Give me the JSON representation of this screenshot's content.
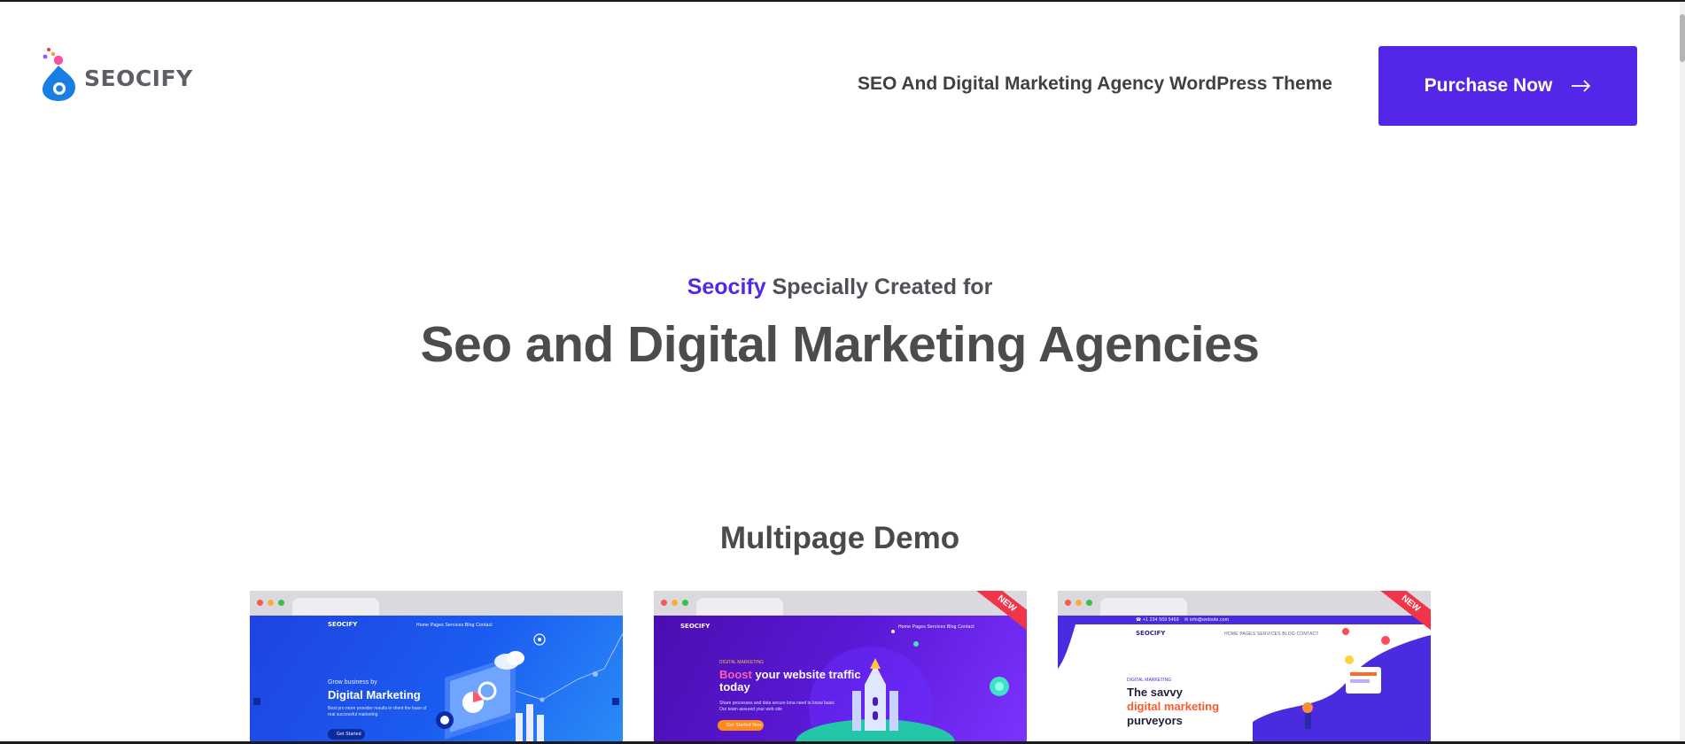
{
  "header": {
    "logo_text": "SEOCIFY",
    "tagline": "SEO And Digital Marketing Agency WordPress Theme",
    "purchase_label": "Purchase Now"
  },
  "hero": {
    "kicker_brand": "Seocify",
    "kicker_rest": " Specially Created for",
    "title": "Seo and Digital Marketing Agencies"
  },
  "section": {
    "title": "Multipage Demo"
  },
  "demos": [
    {
      "logo": "SEOCIFY",
      "nav": "Home     Pages     Services     Blog     Contact",
      "kicker": "Grow business by",
      "headline": "Digital Marketing",
      "paragraph": "Best pro more provider results in client the base of real successful marketing",
      "button": "Get Started"
    },
    {
      "logo": "SEOCIFY",
      "nav": "Home     Pages     Services     Blog     Contact",
      "kicker": "DIGITAL MARKETING",
      "headline_accent": "Boost",
      "headline_rest": " your website traffic today",
      "paragraph": "Share processes and data secure lona need to know basis Our team assured your web site",
      "button": "Get Started Now",
      "badge": "NEW"
    },
    {
      "logo": "SEOCIFY",
      "nav": "HOME     PAGES     SERVICES     BLOG     CONTACT",
      "kicker": "DIGITAL MARKETING",
      "headline_line1": "The savvy",
      "headline_accent": "digital marketing",
      "headline_line3": "purveyors",
      "badge": "NEW"
    }
  ],
  "colors": {
    "brand": "#5426e8",
    "text": "#4a4a4a",
    "badge": "#f0344a",
    "orange": "#ff6a2a"
  }
}
